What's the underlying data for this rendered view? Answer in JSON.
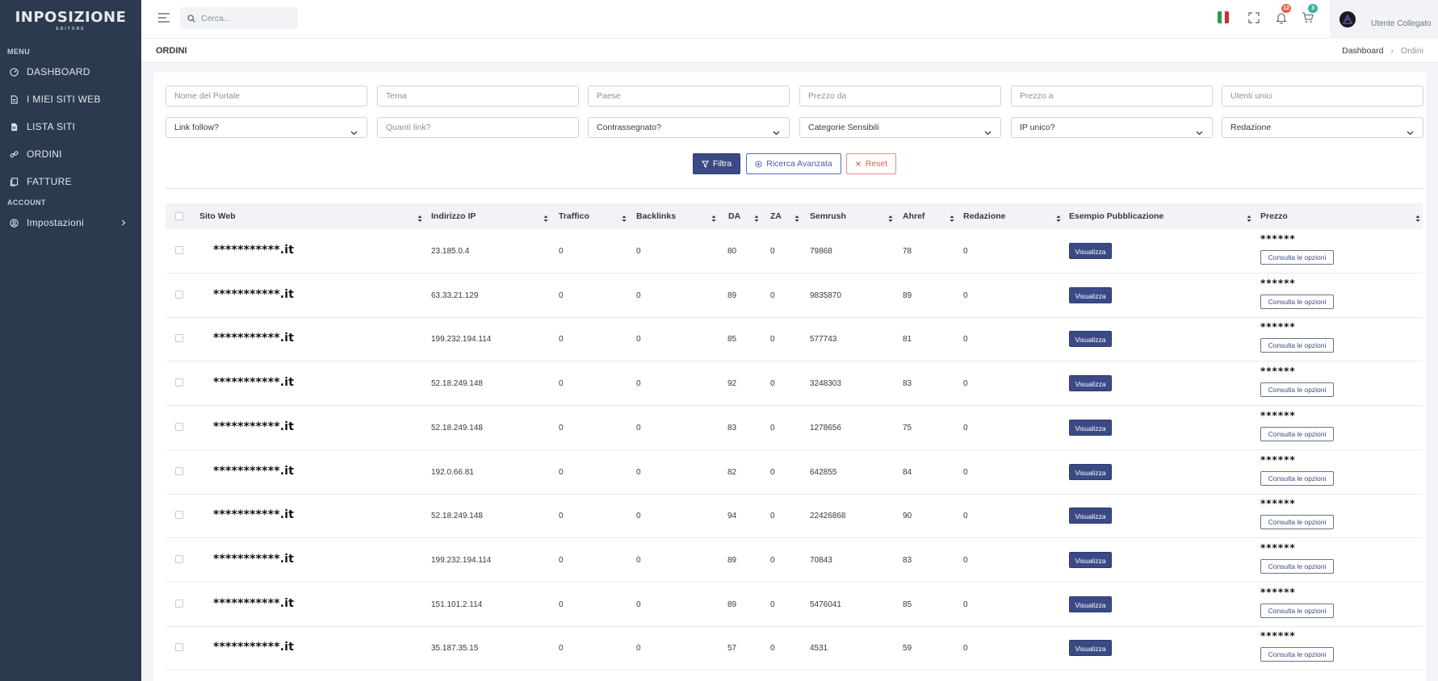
{
  "brand": {
    "name": "INPOSIZIONE",
    "sub": "EDITORE"
  },
  "sidebar": {
    "menu_title": "MENU",
    "items": [
      {
        "label": "DASHBOARD",
        "icon": "dashboard-icon"
      },
      {
        "label": "I MIEI SITI WEB",
        "icon": "document-icon"
      },
      {
        "label": "LISTA SITI",
        "icon": "document-icon"
      },
      {
        "label": "ORDINI",
        "icon": "link-icon"
      },
      {
        "label": "FATTURE",
        "icon": "copy-icon"
      }
    ],
    "account_title": "ACCOUNT",
    "settings_label": "Impostazioni"
  },
  "topbar": {
    "search_placeholder": "Cerca...",
    "notifications_count": "12",
    "cart_count": "3",
    "user_name": "Utente Collegato"
  },
  "page": {
    "title": "ORDINI",
    "breadcrumb": [
      "Dashboard",
      "Ordini"
    ]
  },
  "filters": {
    "row1": [
      "Nome del Portale",
      "Tema",
      "Paese",
      "Prezzo da",
      "Prezzo a",
      "Utenti unici"
    ],
    "row2": [
      {
        "label": "Link follow?",
        "type": "select"
      },
      {
        "label": "Quanti link?",
        "type": "input"
      },
      {
        "label": "Contrassegnato?",
        "type": "select"
      },
      {
        "label": "Categorie Sensibili",
        "type": "select"
      },
      {
        "label": "IP unico?",
        "type": "select"
      },
      {
        "label": "Redazione",
        "type": "select"
      }
    ],
    "btn_filtra": "Filtra",
    "btn_ricerca": "Ricerca Avanzata",
    "btn_reset": "Reset"
  },
  "table": {
    "headers": [
      "Sito Web",
      "Indirizzo IP",
      "Traffico",
      "Backlinks",
      "DA",
      "ZA",
      "Semrush",
      "Ahref",
      "Redazione",
      "Esempio Pubblicazione",
      "Prezzo"
    ],
    "view_label": "Visualizza",
    "options_label": "Consulta le opzioni",
    "price_mask": "******",
    "rows": [
      {
        "site": "***********.it",
        "ip": "23.185.0.4",
        "traffico": "0",
        "backlinks": "0",
        "da": "80",
        "za": "0",
        "semrush": "79868",
        "ahref": "78",
        "redazione": "0"
      },
      {
        "site": "***********.it",
        "ip": "63.33.21.129",
        "traffico": "0",
        "backlinks": "0",
        "da": "89",
        "za": "0",
        "semrush": "9835870",
        "ahref": "89",
        "redazione": "0"
      },
      {
        "site": "***********.it",
        "ip": "199.232.194.114",
        "traffico": "0",
        "backlinks": "0",
        "da": "85",
        "za": "0",
        "semrush": "577743",
        "ahref": "81",
        "redazione": "0"
      },
      {
        "site": "***********.it",
        "ip": "52.18.249.148",
        "traffico": "0",
        "backlinks": "0",
        "da": "92",
        "za": "0",
        "semrush": "3248303",
        "ahref": "83",
        "redazione": "0"
      },
      {
        "site": "***********.it",
        "ip": "52.18.249.148",
        "traffico": "0",
        "backlinks": "0",
        "da": "83",
        "za": "0",
        "semrush": "1278656",
        "ahref": "75",
        "redazione": "0"
      },
      {
        "site": "***********.it",
        "ip": "192.0.66.81",
        "traffico": "0",
        "backlinks": "0",
        "da": "82",
        "za": "0",
        "semrush": "642855",
        "ahref": "84",
        "redazione": "0"
      },
      {
        "site": "***********.it",
        "ip": "52.18.249.148",
        "traffico": "0",
        "backlinks": "0",
        "da": "94",
        "za": "0",
        "semrush": "22426868",
        "ahref": "90",
        "redazione": "0"
      },
      {
        "site": "***********.it",
        "ip": "199.232.194.114",
        "traffico": "0",
        "backlinks": "0",
        "da": "89",
        "za": "0",
        "semrush": "70843",
        "ahref": "83",
        "redazione": "0"
      },
      {
        "site": "***********.it",
        "ip": "151.101.2.114",
        "traffico": "0",
        "backlinks": "0",
        "da": "89",
        "za": "0",
        "semrush": "5476041",
        "ahref": "85",
        "redazione": "0"
      },
      {
        "site": "***********.it",
        "ip": "35.187.35.15",
        "traffico": "0",
        "backlinks": "0",
        "da": "57",
        "za": "0",
        "semrush": "4531",
        "ahref": "59",
        "redazione": "0"
      }
    ]
  }
}
